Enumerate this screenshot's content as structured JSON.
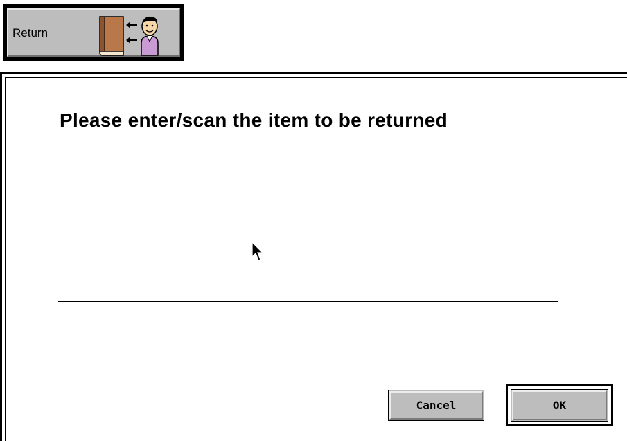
{
  "toolbar": {
    "return_label": "Return",
    "return_icon": "book-return-icon"
  },
  "dialog": {
    "prompt": "Please enter/scan the item to be returned",
    "item_field": {
      "value": "",
      "placeholder": ""
    },
    "cancel_label": "Cancel",
    "ok_label": "OK"
  },
  "colors": {
    "button_face": "#bdbdbd",
    "book": "#b9784a",
    "person_shirt": "#c99ad4"
  }
}
